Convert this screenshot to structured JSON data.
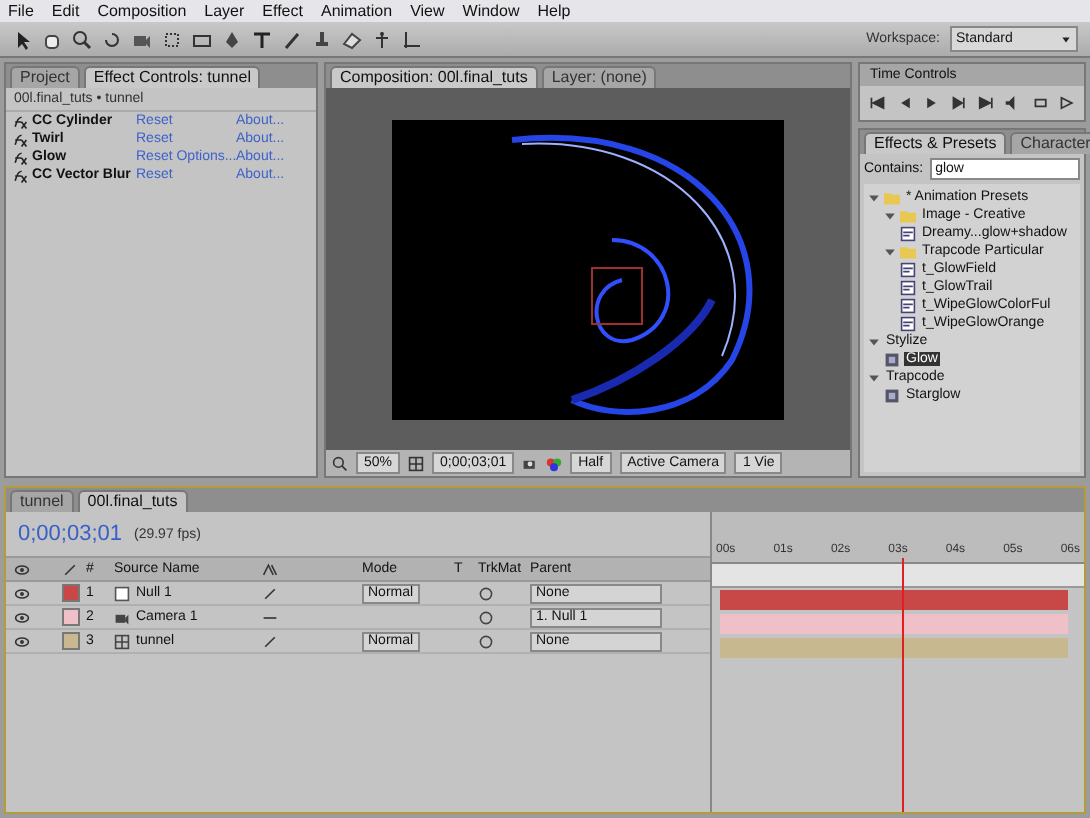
{
  "menu": [
    "File",
    "Edit",
    "Composition",
    "Layer",
    "Effect",
    "Animation",
    "View",
    "Window",
    "Help"
  ],
  "workspace": {
    "label": "Workspace:",
    "value": "Standard"
  },
  "effect_controls": {
    "tabs": [
      {
        "label": "Project",
        "selected": false
      },
      {
        "label": "Effect Controls: tunnel",
        "selected": true
      }
    ],
    "subtitle": "00l.final_tuts • tunnel",
    "effects": [
      {
        "name": "CC Cylinder",
        "reset": "Reset",
        "about": "About..."
      },
      {
        "name": "Twirl",
        "reset": "Reset",
        "about": "About..."
      },
      {
        "name": "Glow",
        "reset": "Reset Options...",
        "about": "About..."
      },
      {
        "name": "CC Vector Blur",
        "reset": "Reset",
        "about": "About..."
      }
    ]
  },
  "composition": {
    "tabs": [
      {
        "label": "Composition: 00l.final_tuts",
        "selected": true
      },
      {
        "label": "Layer: (none)",
        "selected": false
      }
    ],
    "zoom": "50%",
    "time": "0;00;03;01",
    "resolution": "Half",
    "camera": "Active Camera",
    "views": "1 Vie"
  },
  "time_controls": {
    "title": "Time Controls"
  },
  "effects_presets": {
    "tabs": [
      {
        "label": "Effects & Presets",
        "selected": true
      },
      {
        "label": "Character",
        "selected": false
      }
    ],
    "search": {
      "label": "Contains:",
      "value": "glow"
    },
    "tree": [
      {
        "label": "* Animation Presets",
        "kind": "folder",
        "expanded": true,
        "selected": false,
        "children": [
          {
            "label": "Image - Creative",
            "kind": "folder",
            "expanded": true,
            "selected": false,
            "children": [
              {
                "label": "Dreamy...glow+shadow",
                "kind": "preset",
                "selected": false
              }
            ]
          },
          {
            "label": "Trapcode Particular",
            "kind": "folder",
            "expanded": true,
            "selected": false,
            "children": [
              {
                "label": "t_GlowField",
                "kind": "preset",
                "selected": false
              },
              {
                "label": "t_GlowTrail",
                "kind": "preset",
                "selected": false
              },
              {
                "label": "t_WipeGlowColorFul",
                "kind": "preset",
                "selected": false
              },
              {
                "label": "t_WipeGlowOrange",
                "kind": "preset",
                "selected": false
              }
            ]
          }
        ]
      },
      {
        "label": "Stylize",
        "kind": "category",
        "expanded": true,
        "selected": false,
        "children": [
          {
            "label": "Glow",
            "kind": "effect",
            "selected": true
          }
        ]
      },
      {
        "label": "Trapcode",
        "kind": "category",
        "expanded": true,
        "selected": false,
        "children": [
          {
            "label": "Starglow",
            "kind": "effect",
            "selected": false
          }
        ]
      }
    ]
  },
  "timeline": {
    "tabs": [
      {
        "label": "tunnel",
        "selected": false
      },
      {
        "label": "00l.final_tuts",
        "selected": true
      }
    ],
    "time": "0;00;03;01",
    "fps": "(29.97 fps)",
    "columns": [
      "#",
      "Source Name",
      "Mode",
      "T",
      "TrkMat",
      "Parent"
    ],
    "ruler": [
      "00s",
      "01s",
      "02s",
      "03s",
      "04s",
      "05s",
      "06s"
    ],
    "playhead": {
      "level": 0.51
    },
    "layers": [
      {
        "number": "1",
        "name": "Null 1",
        "kind": "null",
        "color": "#c84848",
        "mode": "Normal",
        "parent": "None"
      },
      {
        "number": "2",
        "name": "Camera 1",
        "kind": "camera",
        "color": "#f0c0c8",
        "parent": "1. Null 1"
      },
      {
        "number": "3",
        "name": "tunnel",
        "kind": "comp",
        "color": "#c8b890",
        "mode": "Normal",
        "parent": "None"
      }
    ]
  }
}
